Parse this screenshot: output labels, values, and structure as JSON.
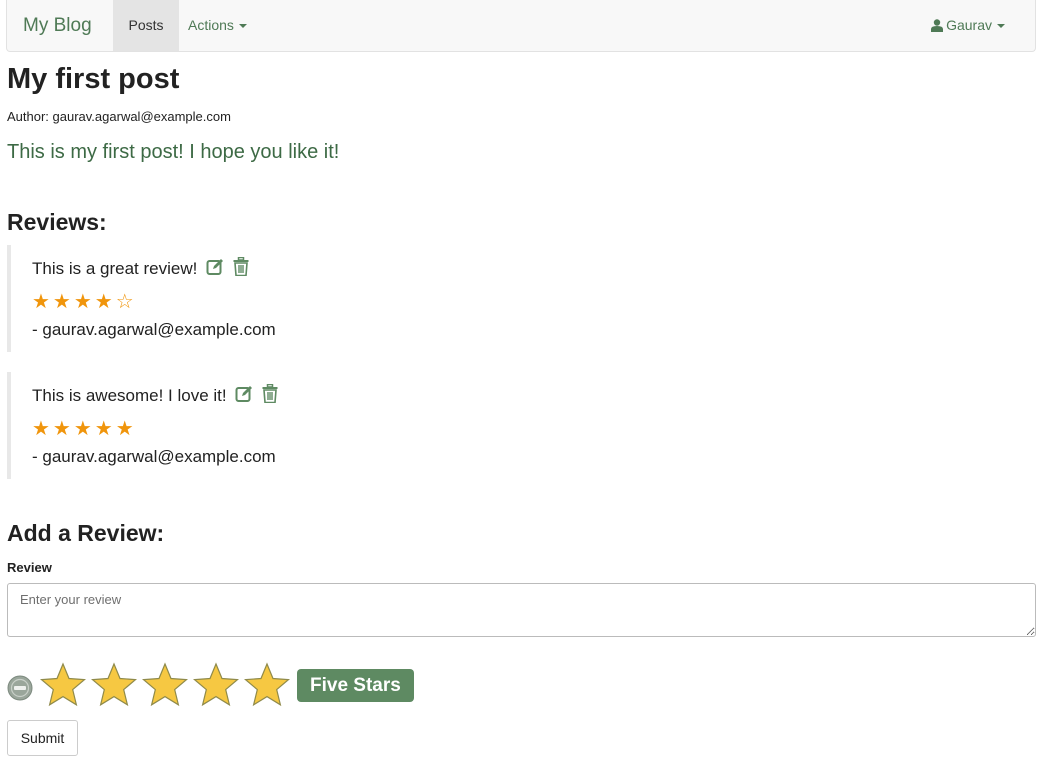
{
  "navbar": {
    "brand": "My Blog",
    "posts_label": "Posts",
    "actions_label": "Actions",
    "user_label": "Gaurav"
  },
  "post": {
    "title": "My first post",
    "author_line": "Author: gaurav.agarwal@example.com",
    "body": "This is my first post! I hope you like it!"
  },
  "reviews_heading": "Reviews:",
  "reviews": [
    {
      "text": "This is a great review!",
      "rating": 4,
      "max_rating": 5,
      "stars_display": "★★★★☆",
      "author": "- gaurav.agarwal@example.com"
    },
    {
      "text": "This is awesome! I love it!",
      "rating": 5,
      "max_rating": 5,
      "stars_display": "★★★★★",
      "author": "- gaurav.agarwal@example.com"
    }
  ],
  "add_review": {
    "heading": "Add a Review:",
    "field_label": "Review",
    "placeholder": "Enter your review",
    "rating": 5,
    "max_rating": 5,
    "caption": "Five Stars",
    "submit_label": "Submit"
  },
  "colors": {
    "accent_green": "#4f7a56",
    "star_orange": "#f0950c",
    "big_star_fill": "#f6c842",
    "caption_bg": "#5e8a62"
  },
  "icons": {
    "edit": "edit-icon",
    "delete": "trash-icon",
    "user": "user-icon",
    "clear": "minus-circle-icon",
    "star": "star-icon"
  }
}
